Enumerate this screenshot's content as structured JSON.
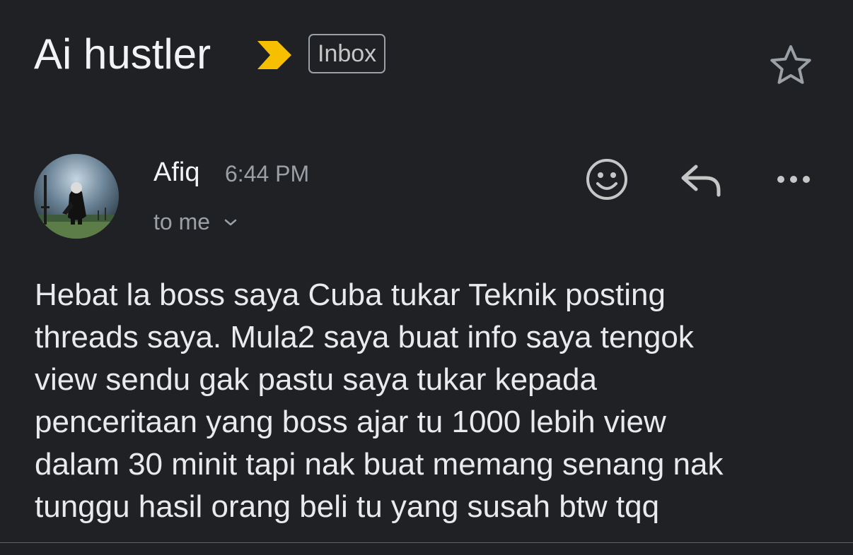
{
  "header": {
    "subject": "Ai hustler",
    "label": "Inbox",
    "importance_color": "#f6c000",
    "star_icon": "star-outline-icon"
  },
  "message": {
    "sender": "Afiq",
    "time": "6:44 PM",
    "recipients": "to me",
    "avatar": "profile-photo-figure-with-sword",
    "actions": [
      "emoji-reaction-icon",
      "reply-icon",
      "more-horizontal-icon"
    ],
    "body": "Hebat la boss saya Cuba tukar Teknik posting\nthreads saya. Mula2 saya buat info saya tengok\nview sendu gak pastu saya tukar kepada\npenceritaan yang boss ajar tu 1000 lebih view\ndalam 30 minit tapi nak buat memang senang nak\ntunggu hasil orang beli tu yang susah btw tqq"
  }
}
